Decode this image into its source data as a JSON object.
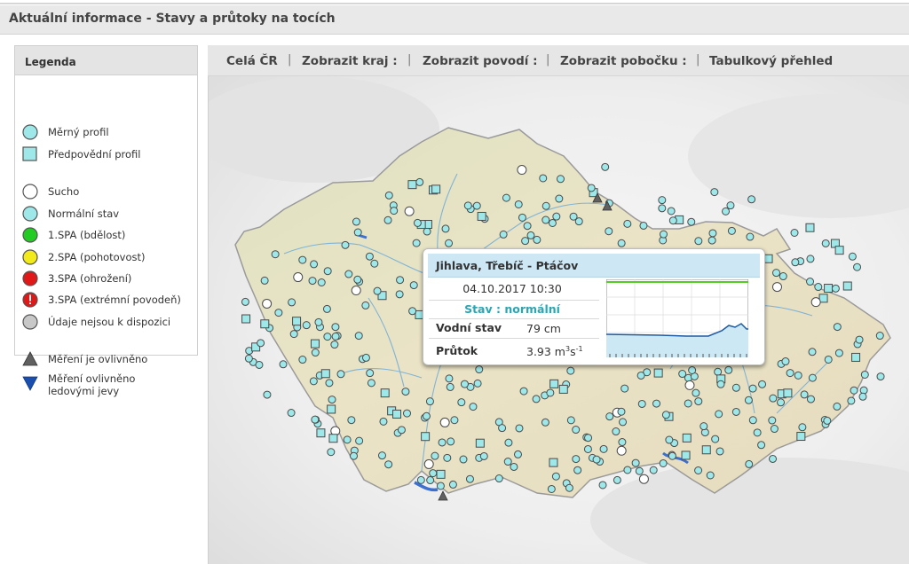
{
  "page_title": "Aktuální informace - Stavy a průtoky na tocích",
  "legend": {
    "title": "Legenda",
    "items": [
      {
        "label": "Měrný profil",
        "icon": "station-circle-icon",
        "color": "#9fe8ea"
      },
      {
        "label": "Předpovědní profil",
        "icon": "forecast-square-icon",
        "color": "#9fe8ea"
      },
      {
        "label": "Sucho",
        "icon": "drought-circle-icon",
        "color": "#ffffff"
      },
      {
        "label": "Normální stav",
        "icon": "normal-circle-icon",
        "color": "#9fe8ea"
      },
      {
        "label": "1.SPA (bdělost)",
        "icon": "spa1-circle-icon",
        "color": "#22cc22"
      },
      {
        "label": "2.SPA (pohotovost)",
        "icon": "spa2-circle-icon",
        "color": "#f2ea1a"
      },
      {
        "label": "3.SPA (ohrožení)",
        "icon": "spa3-circle-icon",
        "color": "#e01818"
      },
      {
        "label": "3.SPA (extrémní povodeň)",
        "icon": "extreme-flood-icon",
        "color": "#e01818"
      },
      {
        "label": "Údaje nejsou k dispozici",
        "icon": "no-data-circle-icon",
        "color": "#c8c8c8"
      },
      {
        "label": "Měření je ovlivněno",
        "icon": "affected-triangle-icon",
        "color": "#606060"
      },
      {
        "label": "Měření ovlivněno ledovými jevy",
        "label_line1": "Měření ovlivněno",
        "label_line2": "ledovými jevy",
        "icon": "ice-triangle-icon",
        "color": "#1a4fb0"
      }
    ]
  },
  "nav": {
    "items": [
      "Celá ČR",
      "Zobrazit kraj :",
      "Zobrazit povodí :",
      "Zobrazit pobočku :",
      "Tabulkový přehled"
    ],
    "separator": "|"
  },
  "map": {
    "region": "Česká republika"
  },
  "popup": {
    "station": "Jihlava, Třebíč - Ptáčov",
    "datetime": "04.10.2017 10:30",
    "status": "Stav : normální",
    "water_level_label": "Vodní stav",
    "water_level_value": "79 cm",
    "flow_label": "Průtok",
    "flow_value": "3.93 m",
    "flow_unit_sup1": "3",
    "flow_unit_mid": "s",
    "flow_unit_sup2": "-1",
    "colors": {
      "status": "#2aa7b4",
      "threshold": "#55cc22",
      "fill": "#cce8f4",
      "line": "#1e5aa0"
    }
  }
}
